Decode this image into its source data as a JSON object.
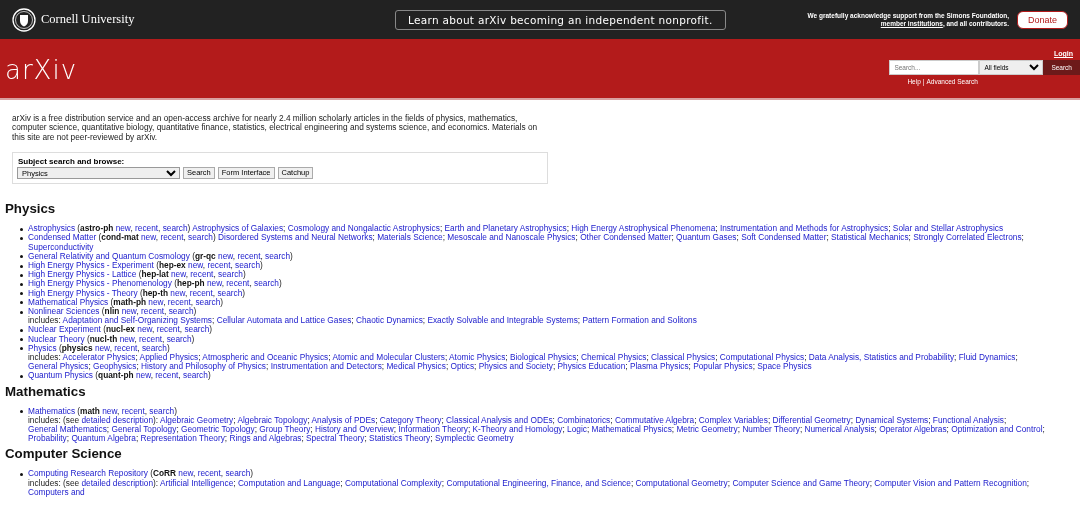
{
  "top_bar": {
    "institution": "Cornell University",
    "banner": "Learn about arXiv becoming an independent nonprofit.",
    "support_text": "We gratefully acknowledge support from the Simons Foundation,",
    "support_link": "member institutions",
    "support_tail": ", and all contributors.",
    "donate": "Donate"
  },
  "brand_bar": {
    "logo": "arXiv",
    "login": "Login",
    "search_placeholder": "Search...",
    "search_field": "All fields",
    "search_button": "Search",
    "help": "Help",
    "divider": "|",
    "advanced": "Advanced Search"
  },
  "intro": "arXiv is a free distribution service and an open-access archive for nearly 2.4 million scholarly articles in the fields of physics, mathematics, computer science, quantitative biology, quantitative finance, statistics, electrical engineering and systems science, and economics. Materials on this site are not peer-reviewed by arXiv.",
  "subject_browse": {
    "label": "Subject search and browse:",
    "selected": "Physics",
    "buttons": [
      "Search",
      "Form Interface",
      "Catchup"
    ]
  },
  "separators": {
    "open": "(",
    "close": ")",
    "comma": ",",
    "semicolon": ";"
  },
  "sections": [
    {
      "title": "Physics",
      "archives": [
        {
          "kind": "inline",
          "name": "Astrophysics",
          "code": "astro-ph",
          "links": [
            "new",
            "recent",
            "search"
          ],
          "subjects": [
            "Astrophysics of Galaxies",
            "Cosmology and Nongalactic Astrophysics",
            "Earth and Planetary Astrophysics",
            "High Energy Astrophysical Phenomena",
            "Instrumentation and Methods for Astrophysics",
            "Solar and Stellar Astrophysics"
          ]
        },
        {
          "kind": "inline",
          "name": "Condensed Matter",
          "code": "cond-mat",
          "links": [
            "new",
            "recent",
            "search"
          ],
          "subjects": [
            "Disordered Systems and Neural Networks",
            "Materials Science",
            "Mesoscale and Nanoscale Physics",
            "Other Condensed Matter",
            "Quantum Gases",
            "Soft Condensed Matter",
            "Statistical Mechanics",
            "Strongly Correlated Electrons",
            "Superconductivity"
          ]
        },
        {
          "kind": "plain",
          "name": "General Relativity and Quantum Cosmology",
          "code": "gr-qc",
          "links": [
            "new",
            "recent",
            "search"
          ]
        },
        {
          "kind": "plain",
          "name": "High Energy Physics - Experiment",
          "code": "hep-ex",
          "links": [
            "new",
            "recent",
            "search"
          ]
        },
        {
          "kind": "plain",
          "name": "High Energy Physics - Lattice",
          "code": "hep-lat",
          "links": [
            "new",
            "recent",
            "search"
          ]
        },
        {
          "kind": "plain",
          "name": "High Energy Physics - Phenomenology",
          "code": "hep-ph",
          "links": [
            "new",
            "recent",
            "search"
          ]
        },
        {
          "kind": "plain",
          "name": "High Energy Physics - Theory",
          "code": "hep-th",
          "links": [
            "new",
            "recent",
            "search"
          ]
        },
        {
          "kind": "plain",
          "name": "Mathematical Physics",
          "code": "math-ph",
          "links": [
            "new",
            "recent",
            "search"
          ]
        },
        {
          "kind": "includes",
          "name": "Nonlinear Sciences",
          "code": "nlin",
          "links": [
            "new",
            "recent",
            "search"
          ],
          "includes_label": "includes:",
          "subjects": [
            "Adaptation and Self-Organizing Systems",
            "Cellular Automata and Lattice Gases",
            "Chaotic Dynamics",
            "Exactly Solvable and Integrable Systems",
            "Pattern Formation and Solitons"
          ]
        },
        {
          "kind": "plain",
          "name": "Nuclear Experiment",
          "code": "nucl-ex",
          "links": [
            "new",
            "recent",
            "search"
          ]
        },
        {
          "kind": "plain",
          "name": "Nuclear Theory",
          "code": "nucl-th",
          "links": [
            "new",
            "recent",
            "search"
          ]
        },
        {
          "kind": "includes",
          "name": "Physics",
          "code": "physics",
          "links": [
            "new",
            "recent",
            "search"
          ],
          "includes_label": "includes:",
          "subjects": [
            "Accelerator Physics",
            "Applied Physics",
            "Atmospheric and Oceanic Physics",
            "Atomic and Molecular Clusters",
            "Atomic Physics",
            "Biological Physics",
            "Chemical Physics",
            "Classical Physics",
            "Computational Physics",
            "Data Analysis, Statistics and Probability",
            "Fluid Dynamics",
            "General Physics",
            "Geophysics",
            "History and Philosophy of Physics",
            "Instrumentation and Detectors",
            "Medical Physics",
            "Optics",
            "Physics and Society",
            "Physics Education",
            "Plasma Physics",
            "Popular Physics",
            "Space Physics"
          ]
        },
        {
          "kind": "plain",
          "name": "Quantum Physics",
          "code": "quant-ph",
          "links": [
            "new",
            "recent",
            "search"
          ]
        }
      ]
    },
    {
      "title": "Mathematics",
      "archives": [
        {
          "kind": "includes",
          "name": "Mathematics",
          "code": "math",
          "links": [
            "new",
            "recent",
            "search"
          ],
          "includes_label": "includes: (see",
          "detail_link": "detailed description",
          "detail_after": "):",
          "subjects": [
            "Algebraic Geometry",
            "Algebraic Topology",
            "Analysis of PDEs",
            "Category Theory",
            "Classical Analysis and ODEs",
            "Combinatorics",
            "Commutative Algebra",
            "Complex Variables",
            "Differential Geometry",
            "Dynamical Systems",
            "Functional Analysis",
            "General Mathematics",
            "General Topology",
            "Geometric Topology",
            "Group Theory",
            "History and Overview",
            "Information Theory",
            "K-Theory and Homology",
            "Logic",
            "Mathematical Physics",
            "Metric Geometry",
            "Number Theory",
            "Numerical Analysis",
            "Operator Algebras",
            "Optimization and Control",
            "Probability",
            "Quantum Algebra",
            "Representation Theory",
            "Rings and Algebras",
            "Spectral Theory",
            "Statistics Theory",
            "Symplectic Geometry"
          ]
        }
      ]
    },
    {
      "title": "Computer Science",
      "archives": [
        {
          "kind": "includes",
          "name": "Computing Research Repository",
          "code": "CoRR",
          "links": [
            "new",
            "recent",
            "search"
          ],
          "includes_label": "includes: (see",
          "detail_link": "detailed description",
          "detail_after": "):",
          "subjects": [
            "Artificial Intelligence",
            "Computation and Language",
            "Computational Complexity",
            "Computational Engineering, Finance, and Science",
            "Computational Geometry",
            "Computer Science and Game Theory",
            "Computer Vision and Pattern Recognition",
            "Computers and"
          ]
        }
      ]
    }
  ]
}
